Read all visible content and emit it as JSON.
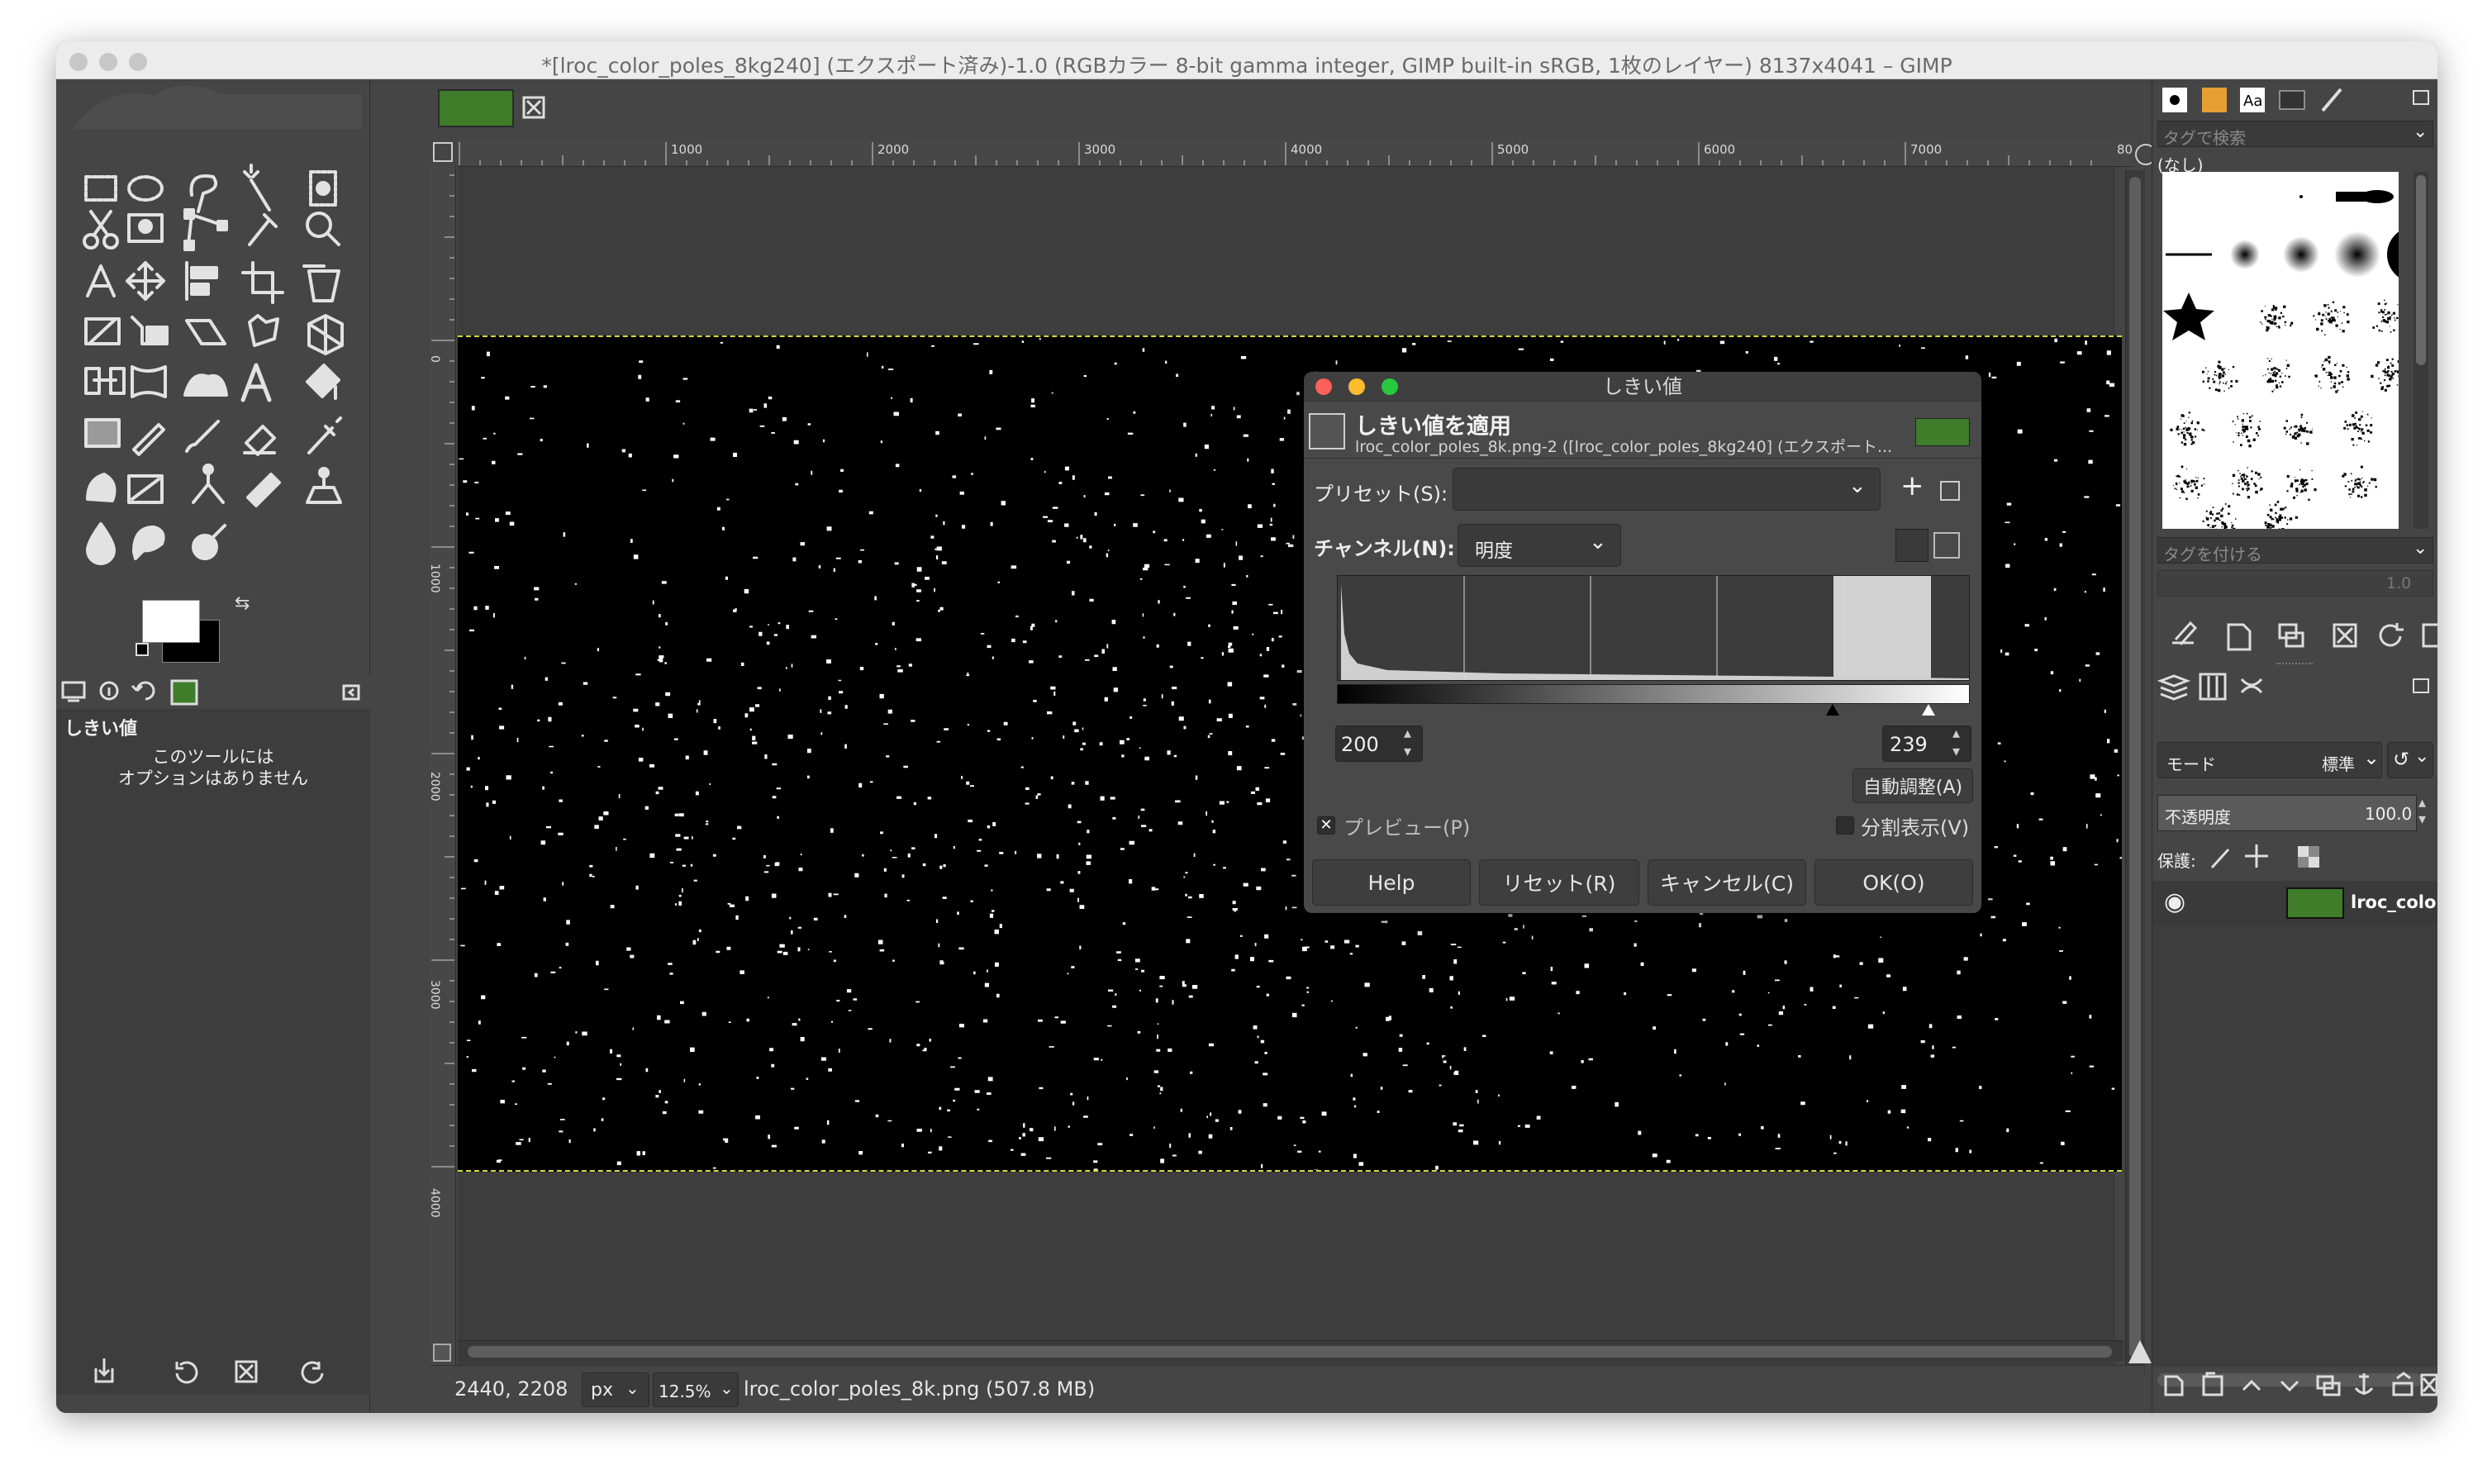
{
  "window": {
    "title": "*[lroc_color_poles_8kg240] (エクスポート済み)-1.0 (RGBカラー 8-bit gamma integer, GIMP built-in sRGB, 1枚のレイヤー) 8137x4041 – GIMP"
  },
  "ruler": {
    "h_labels": [
      "1000",
      "2000",
      "3000",
      "4000",
      "5000",
      "6000",
      "7000",
      "80"
    ],
    "v_labels": [
      "0",
      "1000",
      "2000",
      "3000",
      "4000"
    ]
  },
  "tool_options": {
    "title": "しきい値",
    "message_line1": "このツールには",
    "message_line2": "オプションはありません"
  },
  "threshold_dialog": {
    "title": "しきい値",
    "heading": "しきい値を適用",
    "subheading": "lroc_color_poles_8k.png-2 ([lroc_color_poles_8kg240] (エクスポート...",
    "preset_label": "プリセット(S):",
    "preset_value": "",
    "channel_label": "チャンネル(N):",
    "channel_value": "明度",
    "low_value": "200",
    "high_value": "239",
    "auto_button": "自動調整(A)",
    "preview_label": "プレビュー(P)",
    "preview_checked": "✕",
    "split_label": "分割表示(V)",
    "help_button": "Help",
    "reset_button": "リセット(R)",
    "cancel_button": "キャンセル(C)",
    "ok_button": "OK(O)"
  },
  "status_bar": {
    "coords": "2440, 2208",
    "unit": "px",
    "zoom": "12.5%",
    "file_info": "lroc_color_poles_8k.png (507.8 MB)"
  },
  "brushes": {
    "search_placeholder": "タグで検索",
    "none_label": "(なし)",
    "tag_placeholder": "タグを付ける",
    "spacing_value": "1.0"
  },
  "layers": {
    "mode_label": "モード",
    "mode_value": "標準",
    "opacity_label": "不透明度",
    "opacity_value": "100.0",
    "lock_label": "保護:",
    "layer_name": "lroc_color_poles"
  },
  "colors": {
    "accent_green": "#3f7d2b",
    "fg_color": "#ffffff",
    "bg_color": "#000000"
  }
}
